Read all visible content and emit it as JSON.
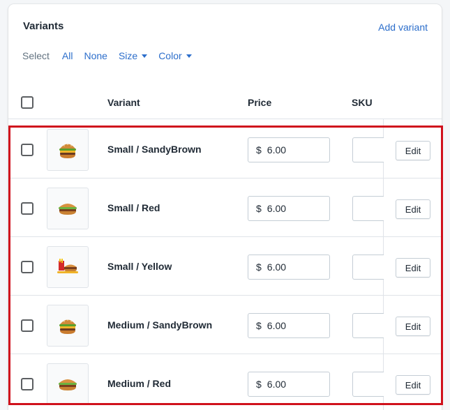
{
  "card": {
    "title": "Variants",
    "add_variant": "Add variant"
  },
  "select": {
    "label": "Select",
    "all": "All",
    "none": "None",
    "size": "Size",
    "color": "Color"
  },
  "table": {
    "headers": {
      "variant": "Variant",
      "price": "Price",
      "sku": "SKU"
    },
    "currency": "$",
    "edit_label": "Edit",
    "rows": [
      {
        "name": "Small / SandyBrown",
        "price": "6.00",
        "image": "burger-icon"
      },
      {
        "name": "Small / Red",
        "price": "6.00",
        "image": "burger-icon"
      },
      {
        "name": "Small / Yellow",
        "price": "6.00",
        "image": "meal-icon"
      },
      {
        "name": "Medium / SandyBrown",
        "price": "6.00",
        "image": "burger-icon"
      },
      {
        "name": "Medium / Red",
        "price": "6.00",
        "image": "burger-icon"
      }
    ]
  },
  "colors": {
    "link": "#2c6ecb",
    "highlight": "#d0111c"
  }
}
